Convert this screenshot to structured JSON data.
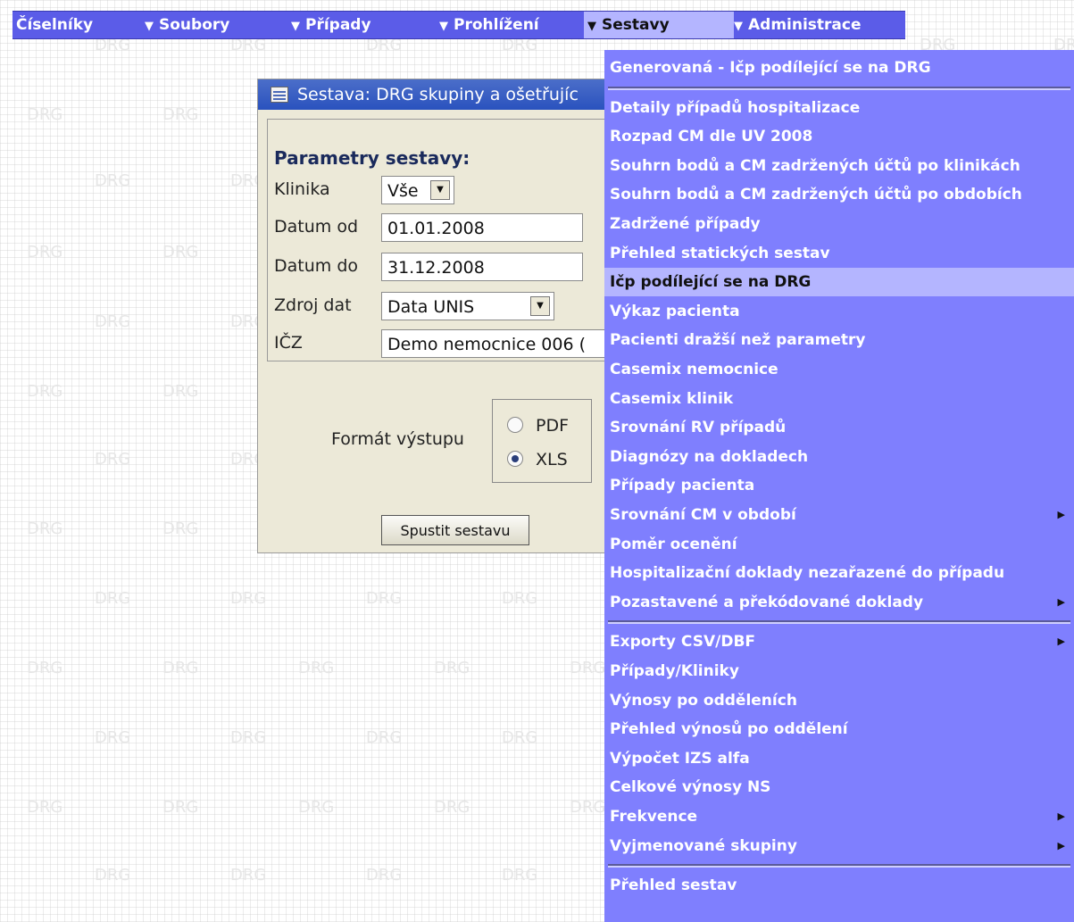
{
  "watermark_text": "DRG",
  "menubar": {
    "items": [
      {
        "label": "Číselníky"
      },
      {
        "label": "Soubory"
      },
      {
        "label": "Případy"
      },
      {
        "label": "Prohlížení"
      },
      {
        "label": "Sestavy",
        "active": true
      },
      {
        "label": "Administrace"
      }
    ],
    "accent_color": "#5b5ce8"
  },
  "dialog": {
    "title": "Sestava: DRG skupiny a ošetřujíc",
    "heading": "Parametry sestavy:",
    "fields": {
      "klinika": {
        "label": "Klinika",
        "value": "Vše"
      },
      "datum_od": {
        "label": "Datum od",
        "value": "01.01.2008"
      },
      "datum_do": {
        "label": "Datum do",
        "value": "31.12.2008"
      },
      "zdroj_dat": {
        "label": "Zdroj dat",
        "value": "Data UNIS"
      },
      "icz": {
        "label": "IČZ",
        "value": "Demo nemocnice 006 ("
      }
    },
    "format": {
      "label": "Formát výstupu",
      "options": [
        {
          "label": "PDF",
          "selected": false
        },
        {
          "label": "XLS",
          "selected": true
        }
      ]
    },
    "run_button": "Spustit sestavu"
  },
  "dropdown": {
    "background": "#7f7ffe",
    "highlight": "#b4b5ff",
    "items": [
      {
        "label": "Generovaná - Ičp podílející se na DRG",
        "sep_after": true
      },
      {
        "label": "Detaily případů hospitalizace"
      },
      {
        "label": "Rozpad CM dle UV 2008"
      },
      {
        "label": "Souhrn bodů a CM zadržených účtů po klinikách"
      },
      {
        "label": "Souhrn bodů a CM zadržených účtů po obdobích"
      },
      {
        "label": "Zadržené případy"
      },
      {
        "label": "Přehled statických sestav"
      },
      {
        "label": "Ičp podílející se na DRG",
        "highlight": true
      },
      {
        "label": "Výkaz pacienta"
      },
      {
        "label": "Pacienti dražší než parametry"
      },
      {
        "label": "Casemix nemocnice"
      },
      {
        "label": "Casemix klinik"
      },
      {
        "label": "Srovnání RV případů"
      },
      {
        "label": "Diagnózy na dokladech"
      },
      {
        "label": "Případy pacienta"
      },
      {
        "label": "Srovnání CM v období",
        "submenu": true
      },
      {
        "label": "Poměr ocenění"
      },
      {
        "label": "Hospitalizační doklady nezařazené do případu"
      },
      {
        "label": "Pozastavené a překódované doklady",
        "submenu": true,
        "sep_after": true
      },
      {
        "label": "Exporty CSV/DBF",
        "submenu": true
      },
      {
        "label": "Případy/Kliniky"
      },
      {
        "label": "Výnosy po odděleních"
      },
      {
        "label": "Přehled výnosů po oddělení"
      },
      {
        "label": "Výpočet IZS alfa"
      },
      {
        "label": "Celkové výnosy NS"
      },
      {
        "label": "Frekvence",
        "submenu": true
      },
      {
        "label": "Vyjmenované skupiny",
        "submenu": true,
        "sep_after": true
      },
      {
        "label": "Přehled sestav"
      }
    ]
  }
}
